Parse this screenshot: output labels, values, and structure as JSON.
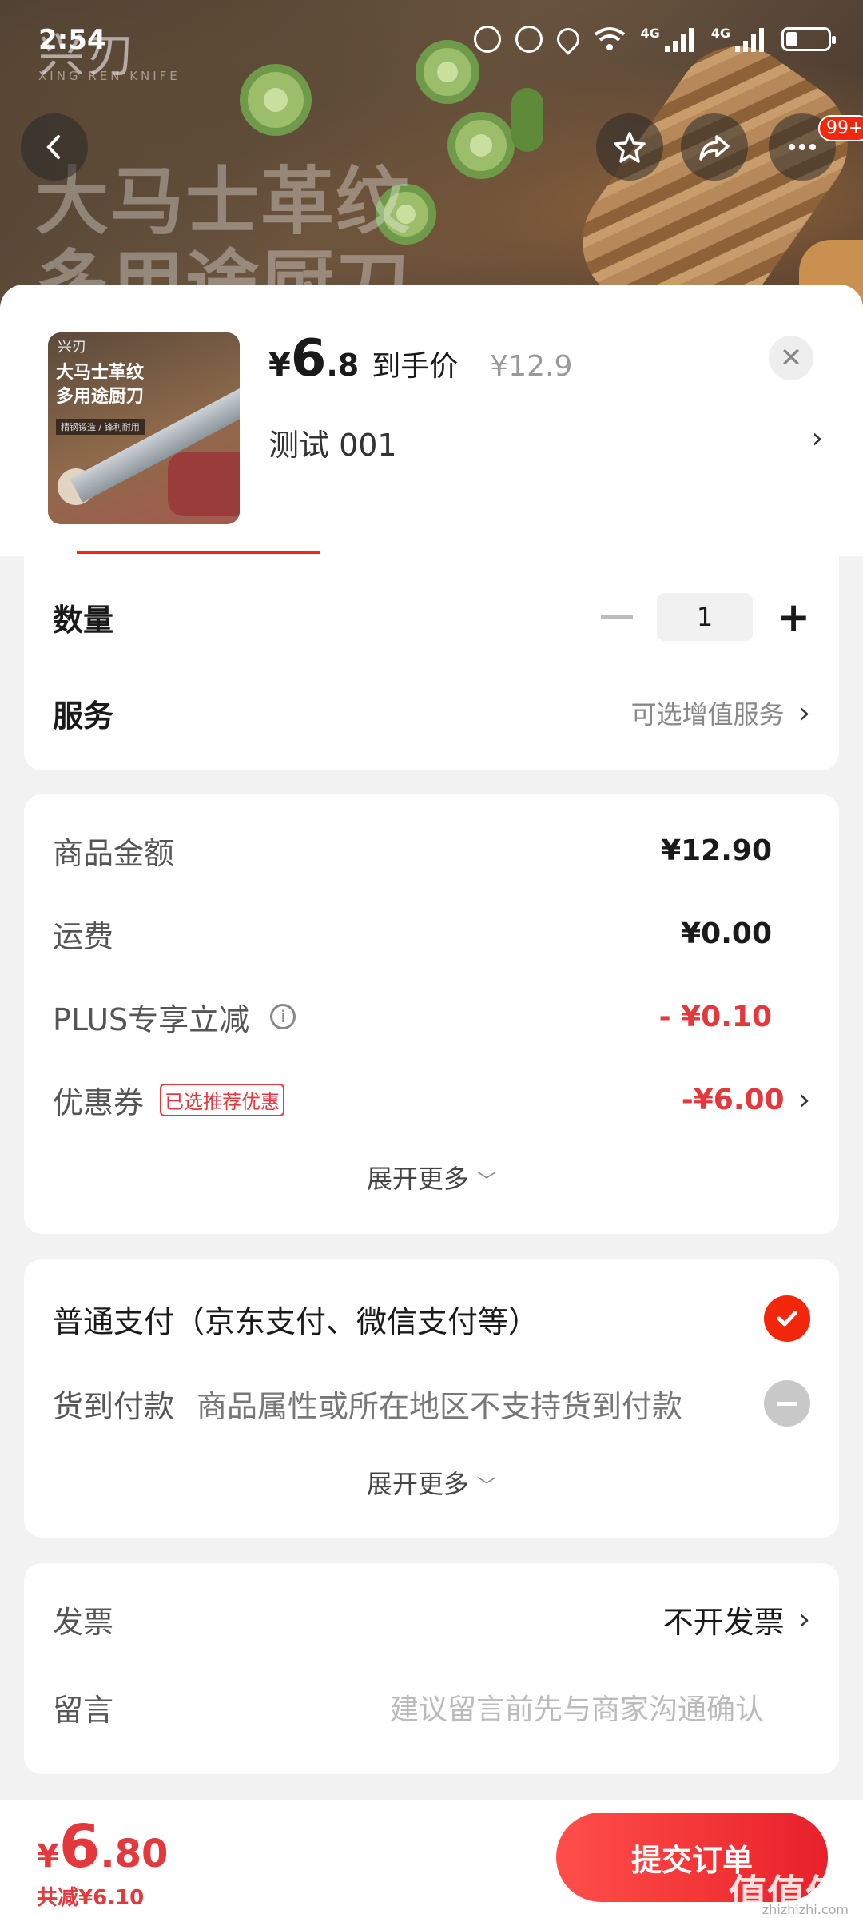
{
  "status": {
    "time": "2:54",
    "network_1": "4G",
    "network_2": "4G"
  },
  "hero": {
    "brand": "兴刃",
    "brand_sub": "XING REN KNIFE",
    "title_line1": "大马士革纹",
    "title_line2": "多用途厨刀"
  },
  "nav": {
    "cart_badge": "99+"
  },
  "product": {
    "thumb_brand": "兴刃",
    "thumb_title_1": "大马士革纹",
    "thumb_title_2": "多用途厨刀",
    "thumb_strip": "精钢锻造 / 锋利耐用",
    "price_symbol": "¥",
    "price_int": "6",
    "price_dec": ".8",
    "price_label": "到手价",
    "original_price": "¥12.9",
    "sku": "测试  001"
  },
  "quantity": {
    "label": "数量",
    "value": "1"
  },
  "service": {
    "label": "服务",
    "value": "可选增值服务"
  },
  "fees": {
    "goods_label": "商品金额",
    "goods_value": "¥12.90",
    "shipping_label": "运费",
    "shipping_value": "¥0.00",
    "plus_label": "PLUS专享立减",
    "plus_value": "- ¥0.10",
    "coupon_label": "优惠券",
    "coupon_tag": "已选推荐优惠",
    "coupon_value": "-¥6.00",
    "expand": "展开更多"
  },
  "payment": {
    "normal": "普通支付（京东支付、微信支付等）",
    "cod_label": "货到付款",
    "cod_note": "商品属性或所在地区不支持货到付款",
    "expand": "展开更多"
  },
  "invoice": {
    "label": "发票",
    "value": "不开发票"
  },
  "remark": {
    "label": "留言",
    "placeholder": "建议留言前先与商家沟通确认"
  },
  "bottom": {
    "symbol": "¥",
    "int": "6",
    "dec": ".80",
    "discount": "共减¥6.10",
    "submit": "提交订单"
  },
  "watermark": {
    "main": "值值值",
    "sub": "zhizhizhi.com"
  },
  "colors": {
    "accent": "#f2270c",
    "price_red": "#e4393c"
  }
}
